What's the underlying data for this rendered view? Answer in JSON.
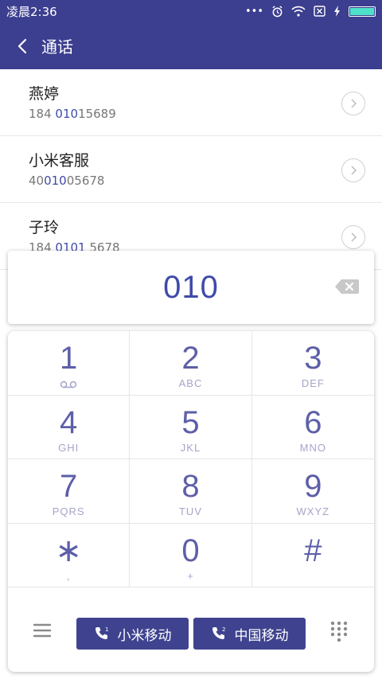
{
  "status_bar": {
    "time": "凌晨2:36",
    "dots": "•••"
  },
  "app_bar": {
    "title": "通话"
  },
  "contacts": [
    {
      "name": "燕婷",
      "number_pre": "184 ",
      "number_hl": "010",
      "number_post": "15689"
    },
    {
      "name": "小米客服",
      "number_pre": "40",
      "number_hl": "010",
      "number_post": "05678"
    },
    {
      "name": "子玲",
      "number_pre": "184 ",
      "number_hl": "0101",
      "number_post": " 5678"
    }
  ],
  "dialer": {
    "input_value": "010"
  },
  "keypad": [
    {
      "digit": "1",
      "letters": ""
    },
    {
      "digit": "2",
      "letters": "ABC"
    },
    {
      "digit": "3",
      "letters": "DEF"
    },
    {
      "digit": "4",
      "letters": "GHI"
    },
    {
      "digit": "5",
      "letters": "JKL"
    },
    {
      "digit": "6",
      "letters": "MNO"
    },
    {
      "digit": "7",
      "letters": "PQRS"
    },
    {
      "digit": "8",
      "letters": "TUV"
    },
    {
      "digit": "9",
      "letters": "WXYZ"
    },
    {
      "digit": "∗",
      "letters": ","
    },
    {
      "digit": "0",
      "letters": "+"
    },
    {
      "digit": "#",
      "letters": ""
    }
  ],
  "actions": {
    "sim1_label": "小米移动",
    "sim1_index": "1",
    "sim2_label": "中国移动",
    "sim2_index": "2"
  },
  "colors": {
    "primary": "#3c3e8f",
    "accent": "#3f4aa9",
    "battery": "#4ee0c8"
  }
}
